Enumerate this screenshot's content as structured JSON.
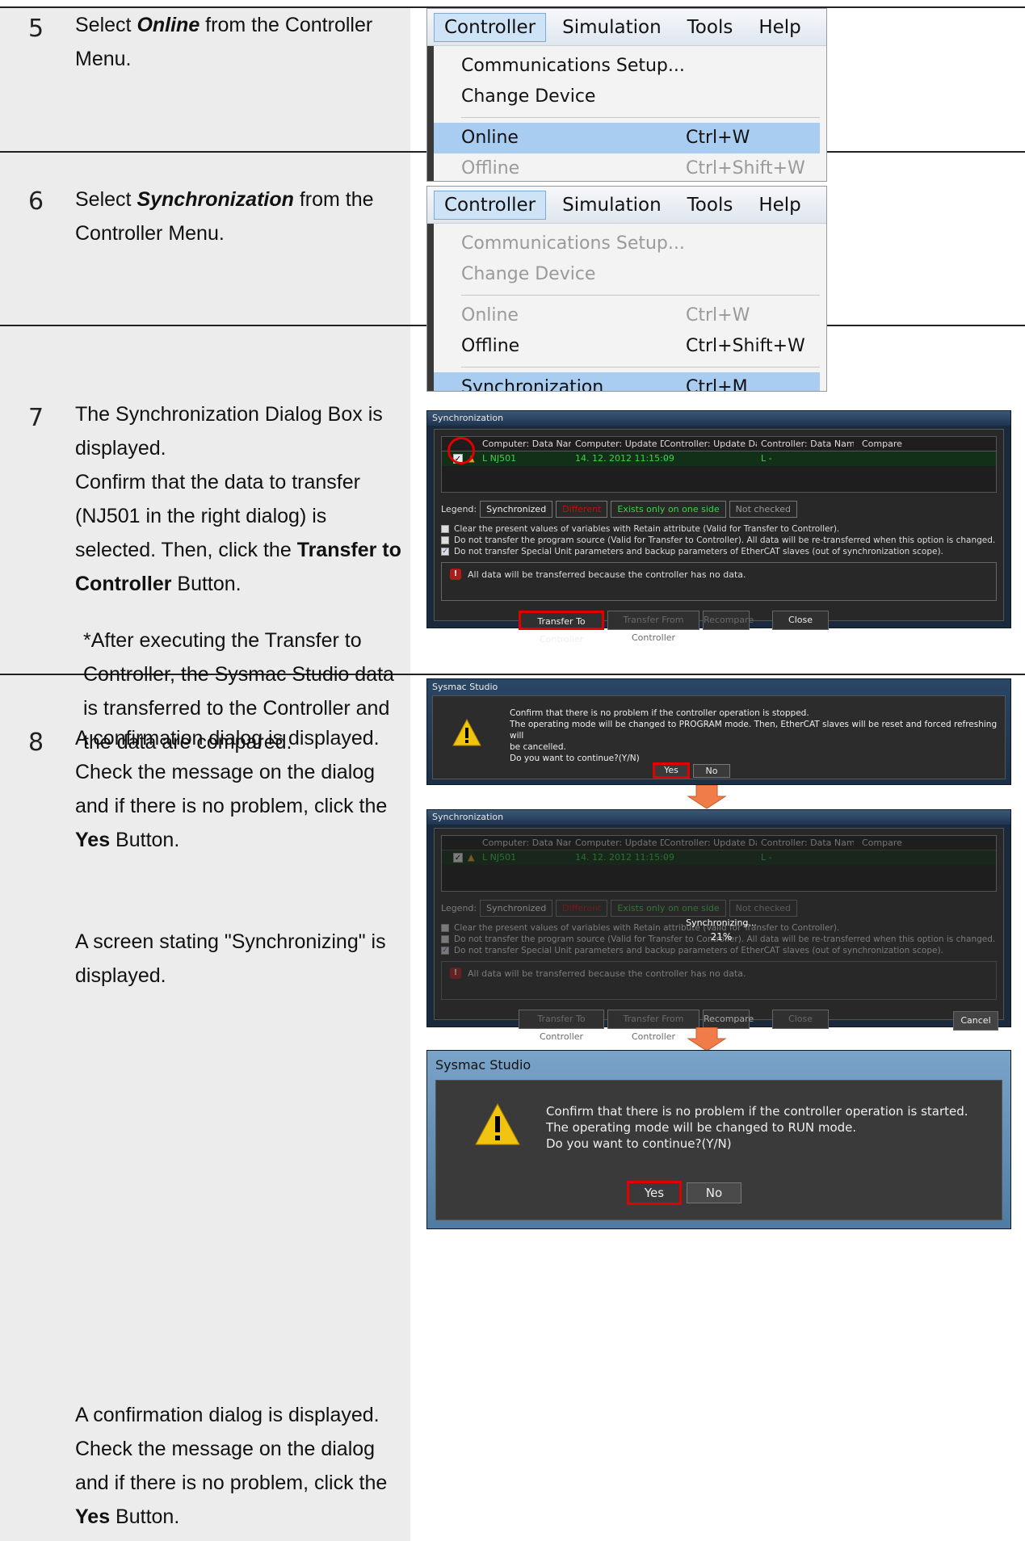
{
  "steps": [
    {
      "number": "5",
      "text_pre": "Select ",
      "text_em": "Online",
      "text_post": " from the Controller Menu."
    },
    {
      "number": "6",
      "text_pre": "Select ",
      "text_em": "Synchronization",
      "text_post": " from the Controller Menu."
    },
    {
      "number": "7",
      "line1": "The Synchronization Dialog Box is displayed.",
      "line2": "Confirm that the data to transfer (NJ501 in the right dialog) is selected. Then, click the ",
      "line2_bold": "Transfer to Controller",
      "line2_post": " Button.",
      "note": "*After executing the Transfer to Controller, the Sysmac Studio data is transferred to the Controller and the data are compared."
    },
    {
      "number": "8",
      "para1_pre": "A confirmation dialog is displayed. Check the message on the dialog and if there is no problem, click the ",
      "para1_bold": "Yes",
      "para1_post": " Button.",
      "para2": "A screen stating \"Synchronizing\" is displayed.",
      "para3_pre": "A confirmation dialog is displayed. Check the message on the dialog and if there is no problem, click the ",
      "para3_bold": "Yes",
      "para3_post": " Button."
    }
  ],
  "menu": {
    "bar": [
      "Controller",
      "Simulation",
      "Tools",
      "Help"
    ],
    "items": {
      "comm_setup": "Communications Setup...",
      "change_device": "Change Device",
      "online": "Online",
      "online_sc": "Ctrl+W",
      "offline": "Offline",
      "offline_sc": "Ctrl+Shift+W",
      "sync": "Synchronization",
      "sync_sc": "Ctrl+M"
    }
  },
  "sync_dialog": {
    "title": "Synchronization",
    "columns": [
      "Computer: Data Name",
      "Computer: Update Da",
      "Controller: Update Da",
      "Controller: Data Name",
      "Compare"
    ],
    "row": {
      "name": "L NJ501",
      "updated": "14. 12. 2012 11:15:09",
      "dash1": "-",
      "ctrl_name": "L -"
    },
    "legend_label": "Legend:",
    "legend": [
      "Synchronized",
      "Different",
      "Exists only on one side",
      "Not checked"
    ],
    "options": [
      {
        "checked": false,
        "text": "Clear the present values of variables with Retain attribute (Valid for Transfer to Controller)."
      },
      {
        "checked": false,
        "text": "Do not transfer the program source (Valid for Transfer to Controller). All data will be re-transferred when this option is changed."
      },
      {
        "checked": true,
        "text": "Do not transfer Special Unit parameters and backup parameters of EtherCAT slaves (out of synchronization scope)."
      }
    ],
    "message": "All data will be transferred because the controller has no data.",
    "buttons": {
      "transfer_to": "Transfer To Controller",
      "transfer_from": "Transfer From Controller",
      "recompare": "Recompare",
      "close": "Close",
      "cancel": "Cancel"
    },
    "synchronizing": "Synchronizing...",
    "progress": "21%"
  },
  "confirm1": {
    "title": "Sysmac Studio",
    "lines": [
      "Confirm that there is no problem if the controller operation is stopped.",
      "The operating mode will be changed to PROGRAM mode. Then, EtherCAT slaves will be reset and forced refreshing will",
      "be cancelled.",
      "Do you want to continue?(Y/N)"
    ],
    "yes": "Yes",
    "no": "No"
  },
  "confirm2": {
    "title": "Sysmac Studio",
    "lines": [
      "Confirm that there is no problem if the controller operation is started.",
      "The operating mode will be changed to RUN mode.",
      "Do you want to continue?(Y/N)"
    ],
    "yes": "Yes",
    "no": "No"
  },
  "colors": {
    "highlight": "#e00000",
    "arrow": "#f07c4a",
    "step_bg": "#ececec"
  }
}
